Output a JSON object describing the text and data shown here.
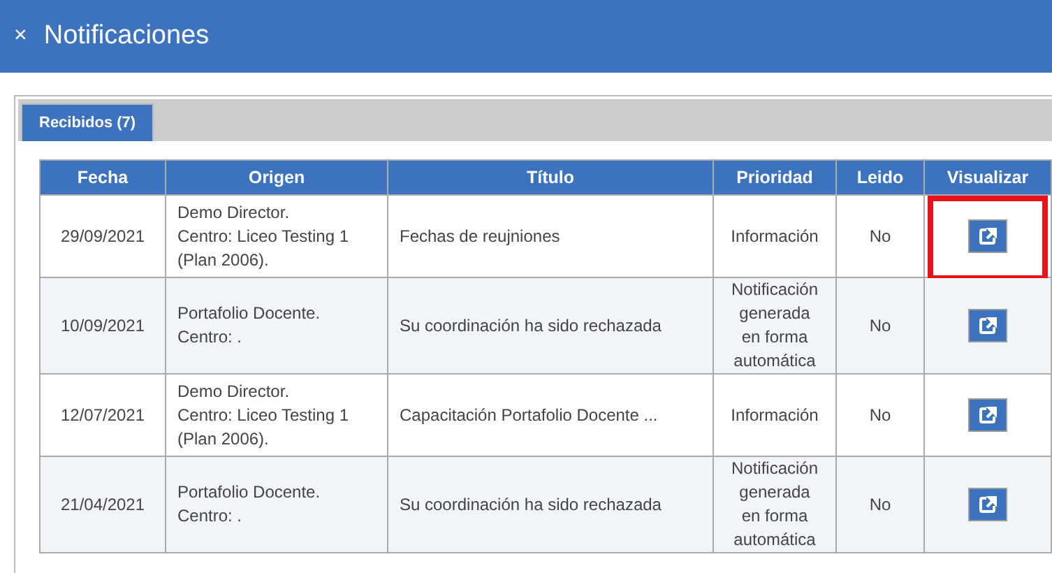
{
  "window": {
    "close": "×",
    "title": "Notificaciones"
  },
  "tabs": [
    {
      "label": "Recibidos (7)",
      "selected": true
    }
  ],
  "table": {
    "columns": [
      "Fecha",
      "Origen",
      "Título",
      "Prioridad",
      "Leido",
      "Visualizar"
    ],
    "rows": [
      {
        "fecha": "29/09/2021",
        "origen": [
          "Demo Director.",
          "Centro: Liceo Testing 1",
          "(Plan 2006)."
        ],
        "titulo": "Fechas de reujniones",
        "prioridad": [
          "Información"
        ],
        "leido": "No",
        "highlighted": true
      },
      {
        "fecha": "10/09/2021",
        "origen": [
          "Portafolio Docente.",
          "Centro: ."
        ],
        "titulo": "Su coordinación ha sido rechazada",
        "prioridad": [
          "Notificación",
          "generada",
          "en forma",
          "automática"
        ],
        "leido": "No",
        "highlighted": false
      },
      {
        "fecha": "12/07/2021",
        "origen": [
          "Demo Director.",
          "Centro: Liceo Testing 1",
          "(Plan 2006)."
        ],
        "titulo": "Capacitación Portafolio Docente ...",
        "prioridad": [
          "Información"
        ],
        "leido": "No",
        "highlighted": false
      },
      {
        "fecha": "21/04/2021",
        "origen": [
          "Portafolio Docente.",
          "Centro: ."
        ],
        "titulo": "Su coordinación ha sido rechazada",
        "prioridad": [
          "Notificación",
          "generada",
          "en forma",
          "automática"
        ],
        "leido": "No",
        "highlighted": false
      }
    ]
  }
}
